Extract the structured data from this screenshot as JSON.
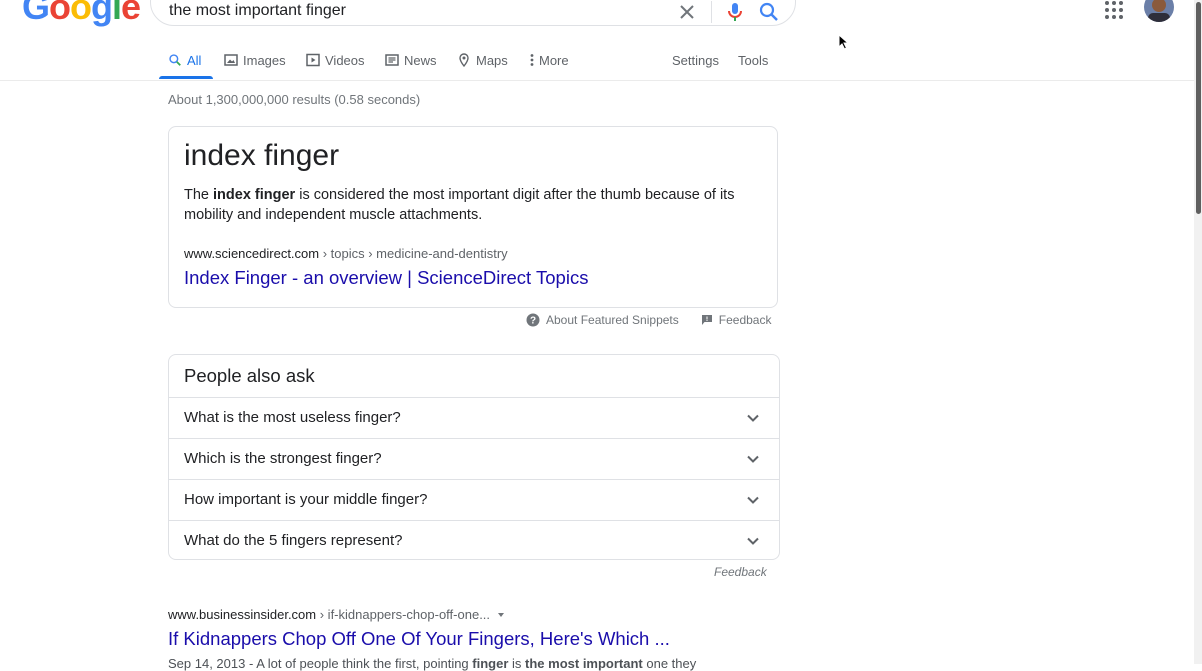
{
  "logo": {
    "text": "Google"
  },
  "search": {
    "query": "the most important finger"
  },
  "tabs": [
    {
      "label": "All"
    },
    {
      "label": "Images"
    },
    {
      "label": "Videos"
    },
    {
      "label": "News"
    },
    {
      "label": "Maps"
    },
    {
      "label": "More"
    }
  ],
  "tools": {
    "settings": "Settings",
    "tools": "Tools"
  },
  "result_stats": "About 1,300,000,000 results (0.58 seconds)",
  "featured_snippet": {
    "answer": "index finger",
    "desc_before": "The ",
    "desc_bold": "index finger",
    "desc_after": " is considered the most important digit after the thumb because of its mobility and independent muscle attachments.",
    "domain": "www.sciencedirect.com",
    "path": " › topics › medicine-and-dentistry",
    "link": "Index Finger - an overview | ScienceDirect Topics",
    "about": "About Featured Snippets",
    "feedback": "Feedback"
  },
  "people_also_ask": {
    "title": "People also ask",
    "questions": [
      "What is the most useless finger?",
      "Which is the strongest finger?",
      "How important is your middle finger?",
      "What do the 5 fingers represent?"
    ],
    "feedback": "Feedback"
  },
  "result2": {
    "domain": "www.businessinsider.com",
    "path": " › if-kidnappers-chop-off-one...",
    "link": "If Kidnappers Chop Off One Of Your Fingers, Here's Which ...",
    "snippet_date": "Sep 14, 2013",
    "snippet_before": " - A lot of people think the first, pointing ",
    "snippet_b1": "finger",
    "snippet_mid": " is ",
    "snippet_b2": "the most important",
    "snippet_after": " one they"
  },
  "colors": {
    "link": "#1a0dab",
    "accent": "#1a73e8",
    "logo_blue": "#4285f4",
    "logo_red": "#ea4335",
    "logo_yellow": "#fbbc05",
    "logo_green": "#34a853"
  },
  "icons": {
    "clear": "close-icon",
    "mic": "mic-icon",
    "search": "search-icon",
    "apps": "apps-grid-icon",
    "chevron": "chevron-down-icon"
  }
}
